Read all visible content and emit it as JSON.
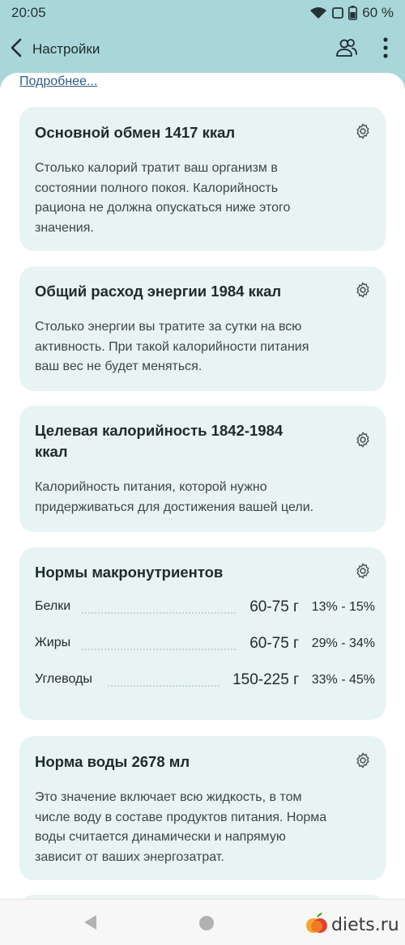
{
  "status": {
    "time": "20:05",
    "battery": "60 %"
  },
  "appbar": {
    "title": "Настройки"
  },
  "more_link": "Подробнее...",
  "cards": {
    "bmr": {
      "title": "Основной обмен 1417 ккал",
      "desc": [
        "Столько калорий тратит ваш организм в",
        "состоянии полного покоя. Калорийность",
        "рациона не должна опускаться ниже этого",
        "значения."
      ]
    },
    "tdee": {
      "title": "Общий расход энергии 1984 ккал",
      "desc": [
        "Столько энергии вы тратите за сутки на всю",
        "активность. При такой калорийности питания",
        "ваш вес не будет меняться."
      ]
    },
    "target": {
      "title": [
        "Целевая калорийность 1842-1984",
        "ккал"
      ],
      "desc": [
        "Калорийность питания, которой нужно",
        "придерживаться для достижения вашей цели."
      ]
    },
    "macros": {
      "title": "Нормы макронутриентов",
      "rows": [
        {
          "name": "Белки",
          "grams": "60-75 г",
          "percent": "13% - 15%"
        },
        {
          "name": "Жиры",
          "grams": "60-75 г",
          "percent": "29% - 34%"
        },
        {
          "name": "Углеводы",
          "grams": "150-225 г",
          "percent": "33% - 45%"
        }
      ]
    },
    "water": {
      "title": "Норма воды 2678 мл",
      "desc": [
        "Это значение включает всю жидкость, в том",
        "числе воду в составе продуктов питания. Норма",
        "воды считается динамически и напрямую",
        "зависит от ваших энергозатрат."
      ]
    }
  },
  "watermark": {
    "text": "diets.ru"
  },
  "icons": {
    "back": "chevron-left-icon",
    "people": "people-icon",
    "more": "more-vert-icon",
    "settings": "gear-icon",
    "wifi": "wifi-icon",
    "battery": "battery-icon",
    "nav_back": "triangle-back-icon",
    "nav_home": "circle-home-icon"
  },
  "colors": {
    "header_bg": "#a9d7d9",
    "card_bg": "#e8f3f3",
    "link": "#2f5c8a"
  }
}
